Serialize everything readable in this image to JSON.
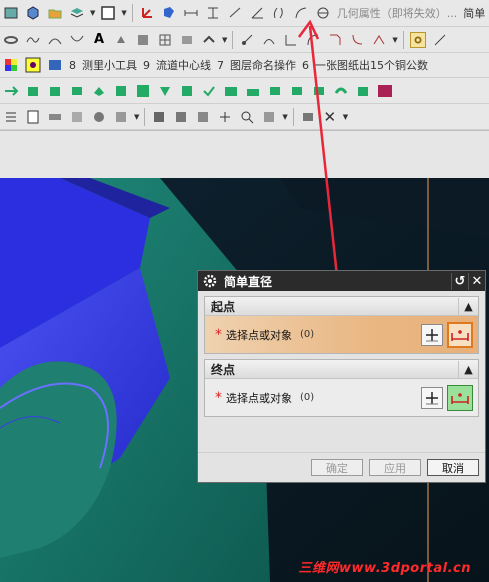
{
  "toolbar": {
    "row1": {
      "trailing_label": "几何属性（即将失效）...",
      "cut_label": "简单"
    },
    "row3": {
      "ids": [
        "8",
        "9",
        "7",
        "6"
      ],
      "labels": [
        "测里小工具",
        "流道中心线",
        "图层命名操作",
        "一张图纸出15个铜公数"
      ]
    }
  },
  "dialog": {
    "title": "简单直径",
    "start": {
      "header": "起点",
      "prompt": "选择点或对象",
      "count": "(0)"
    },
    "end": {
      "header": "终点",
      "prompt": "选择点或对象",
      "count": "(0)"
    },
    "buttons": {
      "ok": "确定",
      "apply": "应用",
      "cancel": "取消"
    }
  },
  "watermark": "三维网www.3dportal.cn",
  "colors": {
    "annotation": "#e8283a",
    "active_bg": "#e9b783",
    "title_bg": "#2b2b2b"
  }
}
